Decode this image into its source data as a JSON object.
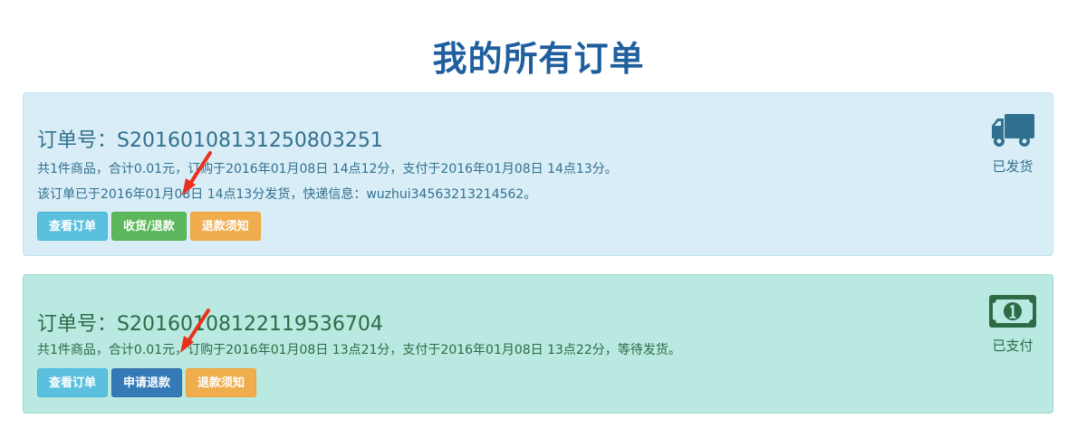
{
  "page": {
    "title": "我的所有订单"
  },
  "orders": [
    {
      "order_no": "订单号：S20160108131250803251",
      "summary": "共1件商品，合计0.01元，订购于2016年01月08日 14点12分，支付于2016年01月08日 14点13分。",
      "shipping": "该订单已于2016年01月08日 14点13分发货，快递信息：wuzhui3456321321456​2。",
      "status_label": "已发货",
      "status_icon": "truck-icon",
      "buttons": {
        "view": "查看订单",
        "receive_refund": "收货/退款",
        "refund_notice": "退款须知"
      }
    },
    {
      "order_no": "订单号：S20160108122119536704",
      "summary": "共1件商品，合计0.01元，订购于2016年01月08日 13点21分，支付于2016年01月08日 13点22分，等待发货。",
      "status_label": "已支付",
      "status_icon": "money-bill-icon",
      "buttons": {
        "view": "查看订单",
        "apply_refund": "申请退款",
        "refund_notice": "退款须知"
      }
    }
  ],
  "colors": {
    "title": "#1f5f9e",
    "shipped_card_bg": "#d9edf7",
    "paid_card_bg": "#b9e9e0",
    "arrow": "#e8321f"
  }
}
